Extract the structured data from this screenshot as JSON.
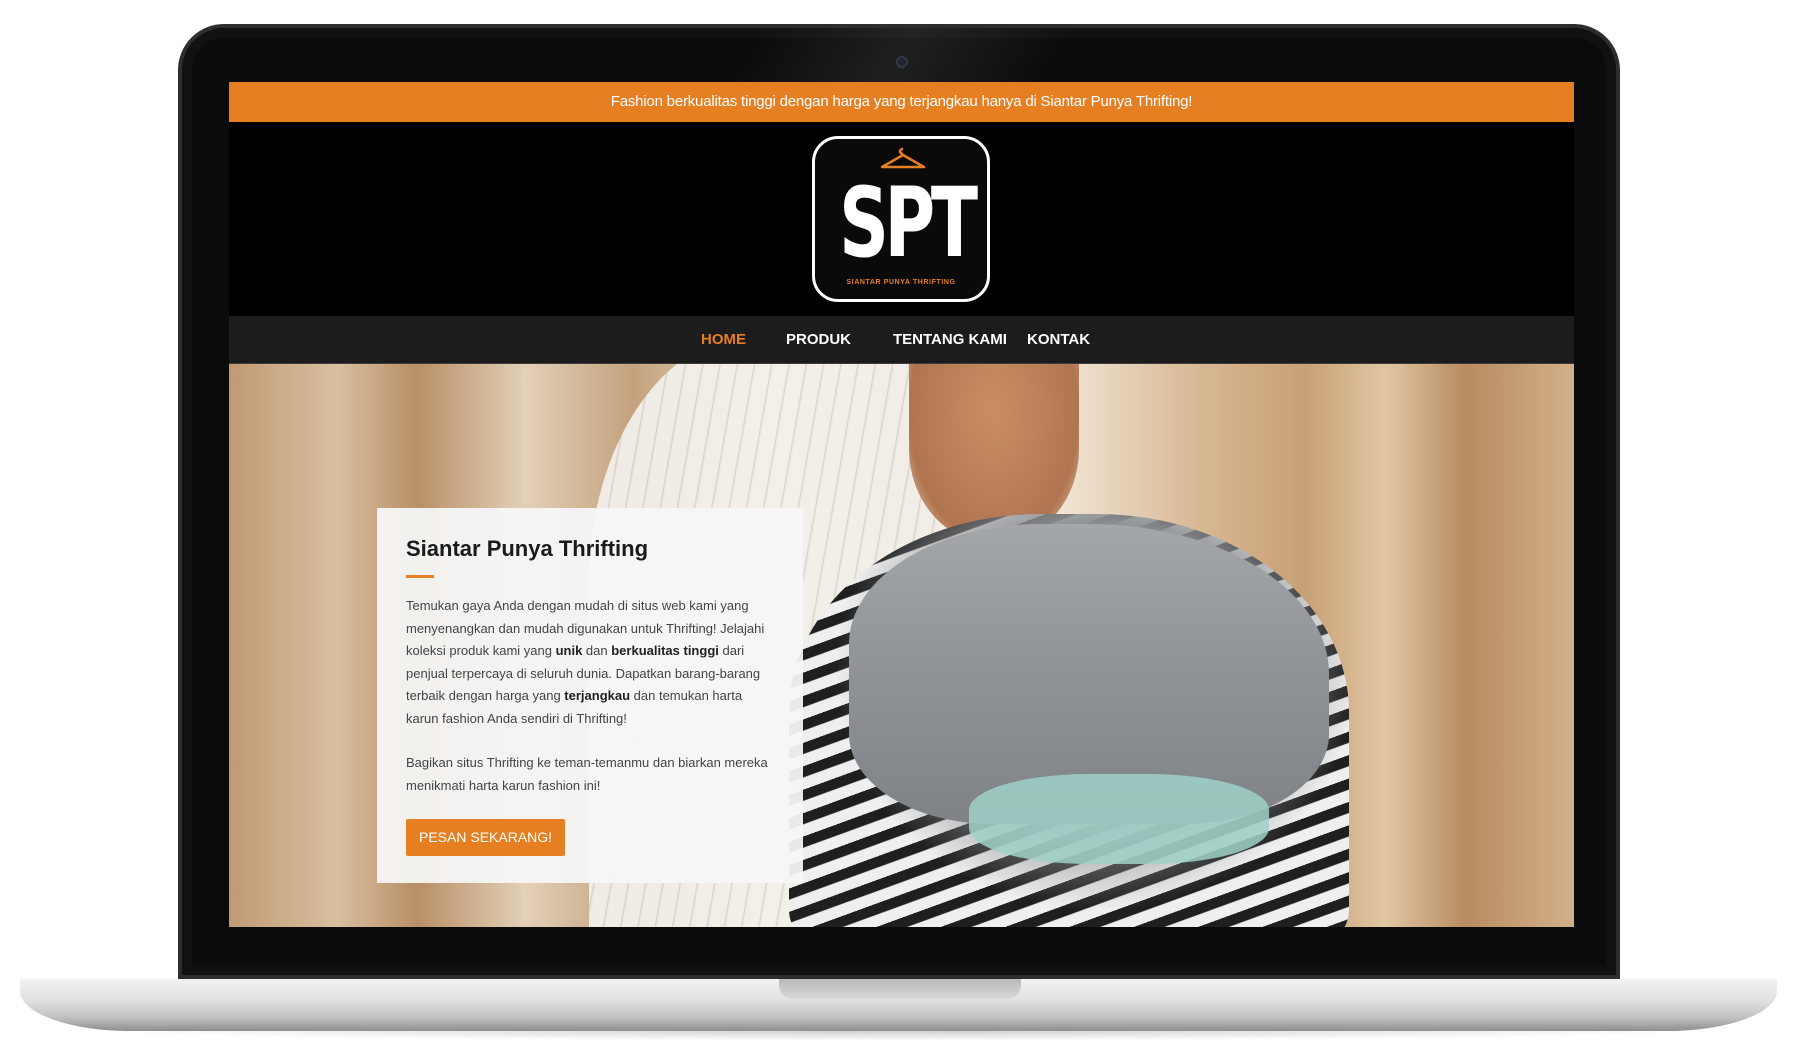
{
  "topbar": {
    "text": "Fashion berkualitas tinggi dengan harga yang terjangkau hanya di Siantar Punya Thrifting!"
  },
  "logo": {
    "letters": "SPT",
    "subtitle": "SIANTAR PUNYA THRIFTING"
  },
  "nav": {
    "items": [
      {
        "label": "HOME",
        "active": true
      },
      {
        "label": "PRODUK",
        "active": false
      },
      {
        "label": "TENTANG KAMI",
        "active": false
      },
      {
        "label": "KONTAK",
        "active": false
      }
    ]
  },
  "hero": {
    "title": "Siantar Punya Thrifting",
    "p1_a": "Temukan gaya Anda dengan mudah di situs web kami yang menyenangkan dan mudah digunakan untuk Thrifting! Jelajahi koleksi produk kami yang ",
    "p1_b1": "unik",
    "p1_c": " dan ",
    "p1_b2": "berkualitas tinggi",
    "p1_d": " dari penjual terpercaya di seluruh dunia. Dapatkan barang-barang terbaik dengan harga yang ",
    "p1_b3": "terjangkau",
    "p1_e": " dan temukan harta karun fashion Anda sendiri di Thrifting!",
    "p2": "Bagikan situs Thrifting ke teman-temanmu dan biarkan mereka menikmati harta karun fashion ini!",
    "button_label": "PESAN SEKARANG!"
  },
  "colors": {
    "accent": "#e67e22",
    "header_bg": "#000000",
    "nav_bg": "#1c1c1c"
  }
}
